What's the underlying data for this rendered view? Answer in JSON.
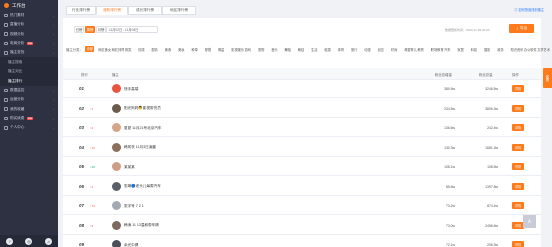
{
  "sidebar": {
    "brand": "工作台",
    "items": [
      {
        "label": "热门素材",
        "icon": "fire-icon"
      },
      {
        "label": "直播分析",
        "icon": "live-icon"
      },
      {
        "label": "视频分析",
        "icon": "video-icon"
      },
      {
        "label": "电商分析",
        "icon": "shop-icon",
        "badge": "new"
      },
      {
        "label": "播主查找",
        "icon": "search-icon"
      }
    ],
    "subitems": [
      "播主搜索",
      "播主对比",
      "播主排行"
    ],
    "items2": [
      {
        "label": "数据监控",
        "icon": "monitor-icon"
      },
      {
        "label": "运营分析",
        "icon": "chart-icon"
      },
      {
        "label": "我的收藏",
        "icon": "star-icon"
      },
      {
        "label": "购买续费",
        "icon": "cart-icon",
        "badge": "new"
      },
      {
        "label": "个人中心",
        "icon": "user-icon"
      }
    ],
    "bottom": [
      "?",
      "◎",
      "♫"
    ]
  },
  "topbar": {
    "tabs": [
      "行业排行榜",
      "涨粉排行榜",
      "成长排行榜",
      "地区排行榜"
    ],
    "active_tab": 1,
    "notice": "◎ 如何快速找到播主"
  },
  "filters": {
    "periods": [
      "日榜",
      "周榜",
      "月榜"
    ],
    "active_period": 1,
    "date_range": "11月02日 - 11月08日",
    "update_text": "数据更新时间：2020-11-09 00:00",
    "export_label": "导出",
    "category_label": "播主分类：",
    "categories": [
      "全部",
      "网红美女",
      "网红帅哥",
      "搞笑",
      "情感",
      "剧情",
      "美食",
      "美妆",
      "种草",
      "穿搭",
      "明星",
      "影视娱乐",
      "游戏",
      "宠物",
      "音乐",
      "舞蹈",
      "萌娃",
      "生活",
      "健康",
      "体育",
      "旅行",
      "动漫",
      "创意",
      "时尚",
      "母婴育儿",
      "教育",
      "职场教育",
      "汽车",
      "家居",
      "科技",
      "摄影",
      "政务",
      "知识资讯",
      "办公软件",
      "文学艺术"
    ],
    "active_category": 0
  },
  "table": {
    "headers": [
      "排行",
      "播主",
      "粉丝总增量",
      "粉丝总量",
      "操作"
    ],
    "detail_label": "详情",
    "rows": [
      {
        "rank": "01",
        "change": "",
        "dir": "",
        "name": "快手高端",
        "inc": "380.5w",
        "total": "3246.5w",
        "color": "#e8553e"
      },
      {
        "rank": "02",
        "change": "↑1",
        "dir": "up",
        "name": "阳光妈妈👨影视带货员",
        "inc": "234.5w",
        "total": "3805.3w",
        "color": "#6b5b4e"
      },
      {
        "rank": "03",
        "change": "↑2",
        "dir": "up",
        "name": "夏夏 11月21号北京汽车",
        "inc": "136.6w",
        "total": "242.4w",
        "color": "#d4a58a"
      },
      {
        "rank": "04",
        "change": "↑13",
        "dir": "up",
        "name": "韩风衣 11月3日凌晨",
        "inc": "130.3w",
        "total": "1681.3w",
        "color": "#8c6e5d"
      },
      {
        "rank": "05",
        "change": "↓28",
        "dir": "down",
        "name": "某某某",
        "inc": "108.1w",
        "total": "108.5w",
        "color": "#cf9c86"
      },
      {
        "rank": "06",
        "change": "↑4",
        "dir": "up",
        "name": "张琳🔵老头儿每周汽车",
        "inc": "85.6w",
        "total": "1397.8w",
        "color": "#5a5f69"
      },
      {
        "rank": "07",
        "change": "↑74",
        "dir": "up",
        "name": "张宇号 7 2 1",
        "inc": "73.2w",
        "total": "874.4w",
        "color": "#a3a9b3"
      },
      {
        "rank": "08",
        "change": "↑9",
        "dir": "up",
        "name": "韩涛 11 13温和带车精",
        "inc": "73.0w",
        "total": "2456.6w",
        "color": "#7c6a5f"
      },
      {
        "rank": "09",
        "change": "",
        "dir": "",
        "name": "余光中健",
        "inc": "72.1w",
        "total": "208.3w",
        "color": "#4b4f5a"
      }
    ]
  },
  "side_tab_label": "客服",
  "totop_label": "∧"
}
